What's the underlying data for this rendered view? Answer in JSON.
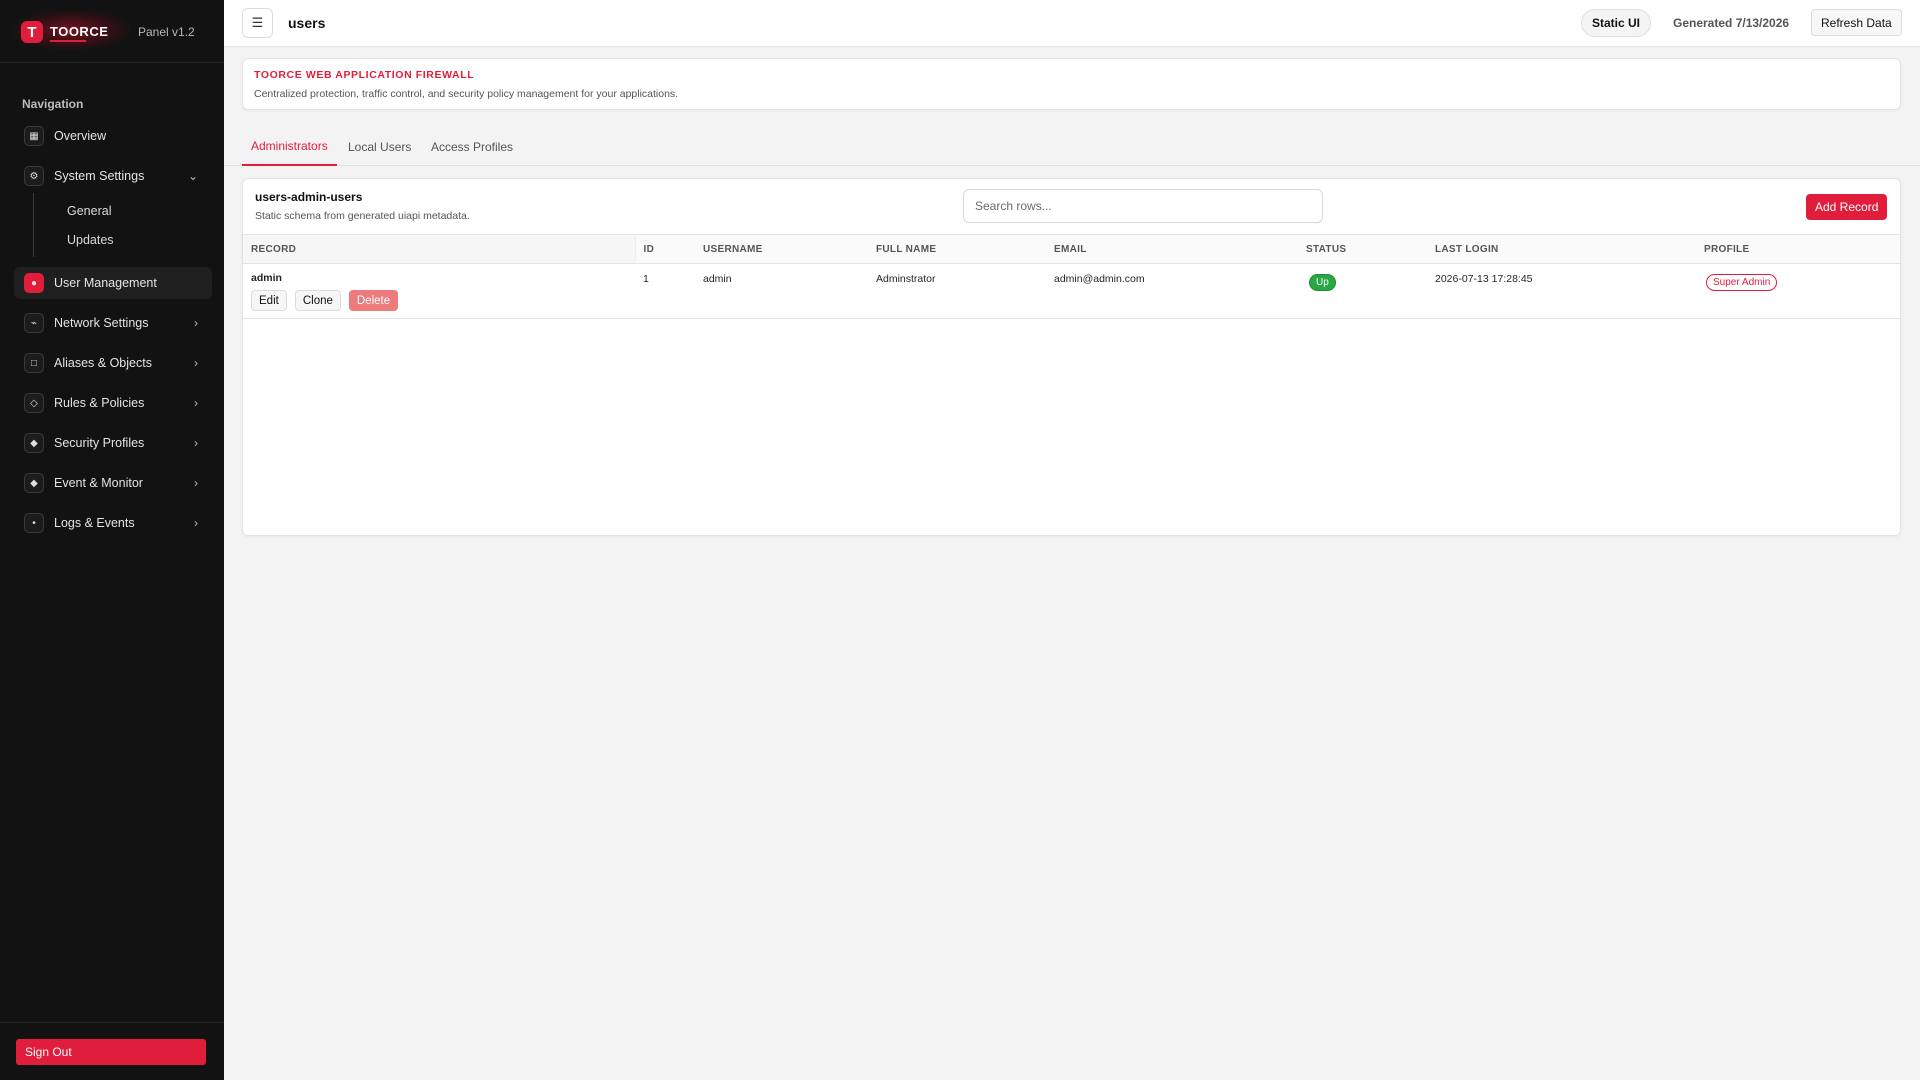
{
  "sidebar": {
    "logo_letter": "T",
    "brand": "TOORCE",
    "panel_version": "Panel v1.2",
    "nav_heading": "Navigation",
    "items": [
      {
        "label": "Overview",
        "icon": "grid-icon",
        "glyph": "▦"
      },
      {
        "label": "System Settings",
        "icon": "gear-icon",
        "glyph": "⚙",
        "expanded": true
      },
      {
        "label": "User Management",
        "icon": "users-icon",
        "glyph": "●",
        "active": true
      },
      {
        "label": "Network Settings",
        "icon": "network-icon",
        "glyph": "⌁"
      },
      {
        "label": "Aliases & Objects",
        "icon": "square-icon",
        "glyph": "□"
      },
      {
        "label": "Rules & Policies",
        "icon": "diamond-outline-icon",
        "glyph": "◇"
      },
      {
        "label": "Security Profiles",
        "icon": "diamond-icon",
        "glyph": "◆"
      },
      {
        "label": "Event & Monitor",
        "icon": "diamond-icon",
        "glyph": "◆"
      },
      {
        "label": "Logs & Events",
        "icon": "dot-icon",
        "glyph": "•"
      }
    ],
    "sub_items": [
      "General",
      "Updates"
    ],
    "sign_out": "Sign Out"
  },
  "topbar": {
    "menu_glyph": "☰",
    "title": "users",
    "static_ui": "Static UI",
    "generated": "Generated 7/13/2026",
    "refresh": "Refresh Data"
  },
  "banner": {
    "title": "TOORCE WEB APPLICATION FIREWALL",
    "subtitle": "Centralized protection, traffic control, and security policy management for your applications."
  },
  "tabs": [
    "Administrators",
    "Local Users",
    "Access Profiles"
  ],
  "card": {
    "title": "users-admin-users",
    "subtitle": "Static schema from generated uiapi metadata.",
    "search_placeholder": "Search rows...",
    "add_button": "Add Record"
  },
  "table": {
    "columns": [
      "RECORD",
      "ID",
      "USERNAME",
      "FULL NAME",
      "EMAIL",
      "STATUS",
      "LAST LOGIN",
      "PROFILE"
    ],
    "rows": [
      {
        "record": "admin",
        "actions": [
          "Edit",
          "Clone",
          "Delete"
        ],
        "id": "1",
        "username": "admin",
        "full_name": "Adminstrator",
        "email": "admin@admin.com",
        "status": "Up",
        "last_login": "2026-07-13 17:28:45",
        "profile": "Super Admin"
      }
    ]
  },
  "colors": {
    "accent": "#e11d3c",
    "sidebar_bg": "#121212",
    "status_up": "#27a844",
    "delete_button": "#ee7b7b"
  }
}
